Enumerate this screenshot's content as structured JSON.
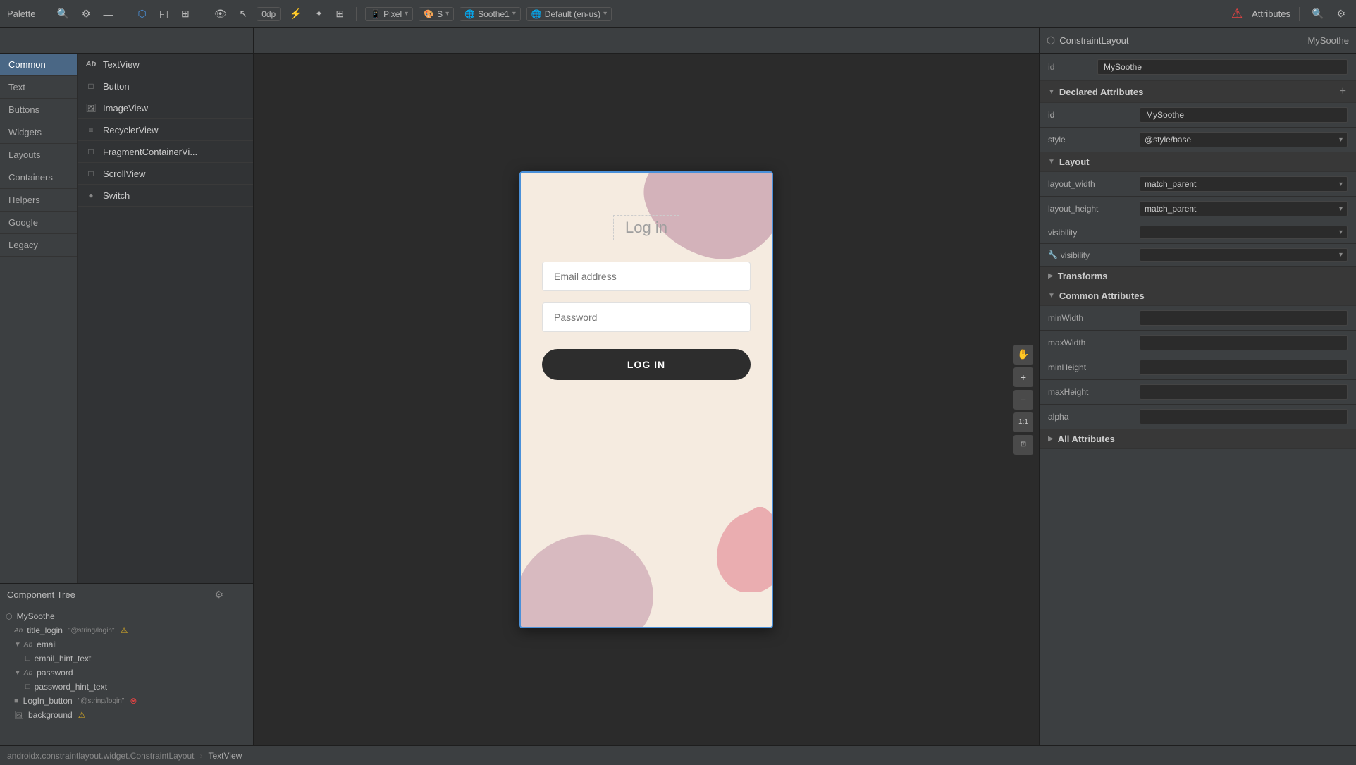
{
  "toolbar": {
    "palette_label": "Palette",
    "device_label": "Pixel",
    "theme_label": "S",
    "locale_label": "Soothe1",
    "locale2_label": "Default (en-us)",
    "dp_label": "0dp",
    "attributes_label": "Attributes"
  },
  "palette_categories": [
    {
      "id": "common",
      "label": "Common",
      "active": true
    },
    {
      "id": "text",
      "label": "Text"
    },
    {
      "id": "buttons",
      "label": "Buttons"
    },
    {
      "id": "widgets",
      "label": "Widgets"
    },
    {
      "id": "layouts",
      "label": "Layouts"
    },
    {
      "id": "containers",
      "label": "Containers"
    },
    {
      "id": "helpers",
      "label": "Helpers"
    },
    {
      "id": "google",
      "label": "Google"
    },
    {
      "id": "legacy",
      "label": "Legacy"
    }
  ],
  "palette_items": [
    {
      "id": "textview",
      "label": "TextView",
      "icon": "Ab"
    },
    {
      "id": "button",
      "label": "Button",
      "icon": "□"
    },
    {
      "id": "imageview",
      "label": "ImageView",
      "icon": "🖼"
    },
    {
      "id": "recyclerview",
      "label": "RecyclerView",
      "icon": "≡"
    },
    {
      "id": "fragmentcontainerview",
      "label": "FragmentContainerVi...",
      "icon": "□"
    },
    {
      "id": "scrollview",
      "label": "ScrollView",
      "icon": "□"
    },
    {
      "id": "switch",
      "label": "Switch",
      "icon": "●"
    }
  ],
  "canvas": {
    "login_title": "Log in",
    "email_placeholder": "Email address",
    "password_placeholder": "Password",
    "login_btn_label": "LOG IN"
  },
  "component_tree": {
    "title": "Component Tree",
    "items": [
      {
        "id": "mysoothe",
        "label": "MySoothe",
        "indent": 0,
        "icon": "⬡",
        "type": "root"
      },
      {
        "id": "title_login",
        "label": "title_login",
        "indent": 1,
        "icon": "Ab",
        "badge": "\"@string/login\"",
        "has_warning": true
      },
      {
        "id": "email",
        "label": "email",
        "indent": 1,
        "icon": "Ab",
        "has_expand": true
      },
      {
        "id": "email_hint_text",
        "label": "email_hint_text",
        "indent": 2,
        "icon": "□"
      },
      {
        "id": "password",
        "label": "password",
        "indent": 1,
        "icon": "Ab",
        "has_expand": true
      },
      {
        "id": "password_hint_text",
        "label": "password_hint_text",
        "indent": 2,
        "icon": "□"
      },
      {
        "id": "login_button",
        "label": "LogIn_button",
        "indent": 1,
        "icon": "■",
        "badge": "\"@string/login\"",
        "has_error": true
      },
      {
        "id": "background",
        "label": "background",
        "indent": 1,
        "icon": "🖼",
        "has_warning": true
      }
    ]
  },
  "attributes": {
    "panel_title": "Attributes",
    "component_type": "ConstraintLayout",
    "component_name": "MySoothe",
    "id_label": "id",
    "id_value": "MySoothe",
    "sections": {
      "declared": {
        "title": "Declared Attributes",
        "rows": [
          {
            "label": "id",
            "value": "MySoothe",
            "type": "text"
          },
          {
            "label": "style",
            "value": "@style/base",
            "type": "dropdown"
          }
        ]
      },
      "layout": {
        "title": "Layout",
        "rows": [
          {
            "label": "layout_width",
            "value": "match_parent",
            "type": "dropdown"
          },
          {
            "label": "layout_height",
            "value": "match_parent",
            "type": "dropdown"
          },
          {
            "label": "visibility",
            "value": "",
            "type": "dropdown"
          },
          {
            "label": "visibility",
            "value": "",
            "type": "dropdown",
            "has_icon": true
          }
        ]
      },
      "transforms": {
        "title": "Transforms",
        "collapsed": true
      },
      "common": {
        "title": "Common Attributes",
        "rows": [
          {
            "label": "minWidth",
            "value": "",
            "type": "text"
          },
          {
            "label": "maxWidth",
            "value": "",
            "type": "text"
          },
          {
            "label": "minHeight",
            "value": "",
            "type": "text"
          },
          {
            "label": "maxHeight",
            "value": "",
            "type": "text"
          },
          {
            "label": "alpha",
            "value": "",
            "type": "text"
          }
        ]
      },
      "all": {
        "title": "All Attributes",
        "collapsed": true
      }
    }
  },
  "breadcrumb": {
    "items": [
      {
        "label": "androidx.constraintlayout.widget.ConstraintLayout",
        "active": false
      },
      {
        "label": "TextView",
        "active": true
      }
    ]
  }
}
